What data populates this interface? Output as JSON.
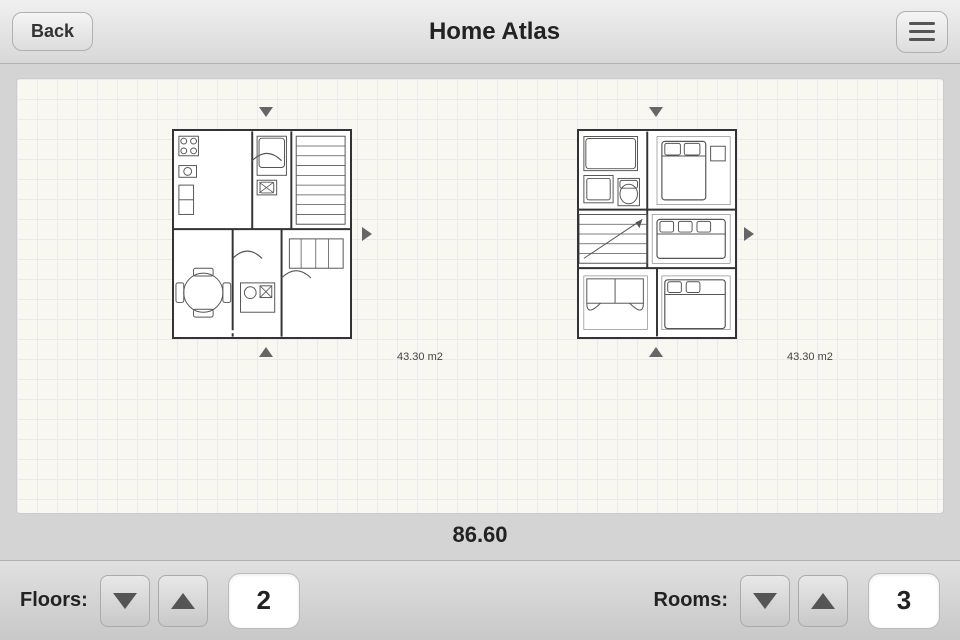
{
  "header": {
    "title": "Home Atlas",
    "back_label": "Back"
  },
  "blueprint": {
    "floor1_area": "43.30 m2",
    "floor2_area": "43.30 m2",
    "total_area": "86.60"
  },
  "controls": {
    "floors_label": "Floors:",
    "floors_value": "2",
    "rooms_label": "Rooms:",
    "rooms_value": "3"
  }
}
